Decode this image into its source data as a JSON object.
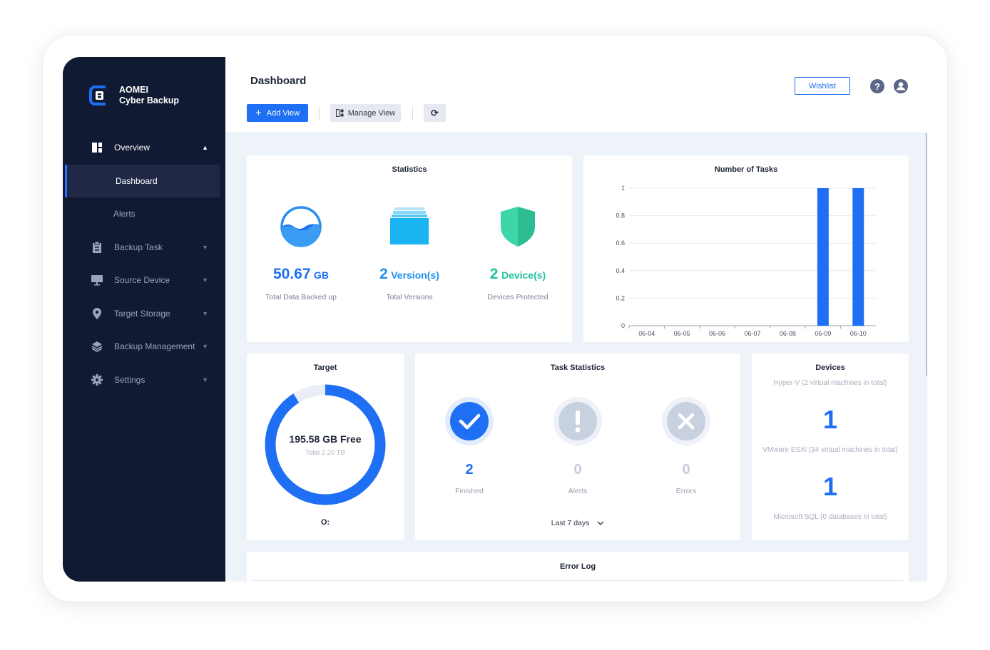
{
  "app": {
    "brand_line1": "AOMEI",
    "brand_line2": "Cyber Backup"
  },
  "sidebar": {
    "overview": {
      "label": "Overview",
      "chevron": "chevron-up-icon"
    },
    "sub_items": [
      {
        "label": "Dashboard",
        "active": true
      },
      {
        "label": "Alerts",
        "active": false
      }
    ],
    "items": [
      {
        "label": "Backup Task",
        "icon": "clipboard-icon"
      },
      {
        "label": "Source Device",
        "icon": "monitor-icon"
      },
      {
        "label": "Target Storage",
        "icon": "location-pin-icon"
      },
      {
        "label": "Backup Management",
        "icon": "layers-icon"
      },
      {
        "label": "Settings",
        "icon": "gear-icon"
      }
    ]
  },
  "header": {
    "title": "Dashboard",
    "add_view": "Add View",
    "manage_view": "Manage View",
    "wishlist": "Wishlist"
  },
  "statistics": {
    "title": "Statistics",
    "data_value": "50.67",
    "data_unit": "GB",
    "data_label": "Total Data Backed up",
    "versions_value": "2",
    "versions_unit": "Version(s)",
    "versions_label": "Total Versions",
    "devices_value": "2",
    "devices_unit": "Device(s)",
    "devices_label": "Devices Protected"
  },
  "tasks_chart": {
    "title": "Number of Tasks",
    "y_ticks": [
      "1",
      "0.8",
      "0.6",
      "0.4",
      "0.2",
      "0"
    ]
  },
  "chart_data": {
    "type": "bar",
    "title": "Number of Tasks",
    "categories": [
      "06-04",
      "06-05",
      "06-06",
      "06-07",
      "06-08",
      "06-09",
      "06-10"
    ],
    "values": [
      0,
      0,
      0,
      0,
      0,
      1,
      1
    ],
    "ylim": [
      0,
      1
    ],
    "color": "#1e6ff3"
  },
  "target": {
    "title": "Target",
    "free": "195.58 GB Free",
    "total": "Total 2.20 TB",
    "drive": "O:",
    "used_fraction": 0.089,
    "color": "#1e6ff3"
  },
  "task_stats": {
    "title": "Task Statistics",
    "finished_value": "2",
    "finished_label": "Finished",
    "alerts_value": "0",
    "alerts_label": "Alerts",
    "errors_value": "0",
    "errors_label": "Errors",
    "period": "Last 7 days"
  },
  "devices": {
    "title": "Devices",
    "hyperv_caption": "Hyper-V (2 virtual machines in total)",
    "hyperv_value": "1",
    "vmware_caption": "VMware ESXi (34 virtual machines in total)",
    "vmware_value": "1",
    "sql_caption": "Microsoft SQL (0 databases in total)"
  },
  "error_log": {
    "title": "Error Log"
  }
}
